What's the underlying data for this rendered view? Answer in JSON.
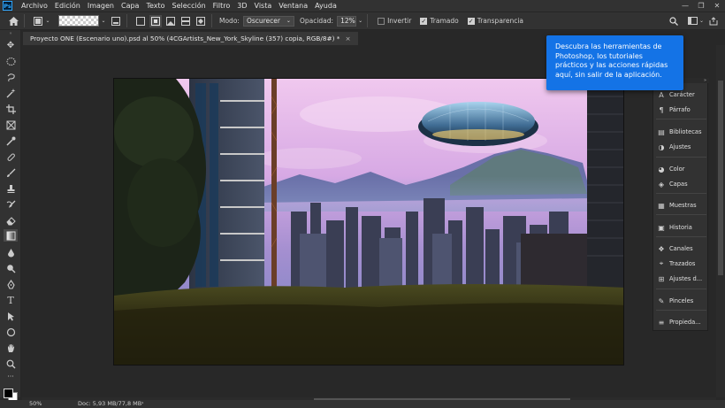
{
  "app": {
    "logo": "Ps"
  },
  "menu": [
    "Archivo",
    "Edición",
    "Imagen",
    "Capa",
    "Texto",
    "Selección",
    "Filtro",
    "3D",
    "Vista",
    "Ventana",
    "Ayuda"
  ],
  "window_controls": {
    "minimize": "—",
    "restore": "❐",
    "close": "✕"
  },
  "options": {
    "mode_label": "Modo:",
    "mode_value": "Oscurecer",
    "opacity_label": "Opacidad:",
    "opacity_value": "12%",
    "invertir_label": "Invertir",
    "invertir_checked": false,
    "tramado_label": "Tramado",
    "tramado_checked": true,
    "transparencia_label": "Transparencia",
    "transparencia_checked": true
  },
  "document": {
    "tab_title": "Proyecto ONE (Escenario uno).psd al 50% (4CGArtists_New_York_Skyline (357) copia, RGB/8#) *",
    "close": "×"
  },
  "status": {
    "zoom": "50%",
    "doc_size": "Doc: 5,93 MB/77,8 MB",
    "arrow": "›"
  },
  "tooltip": {
    "text": "Descubra las herramientas de Photoshop, los tutoriales prácticos y las acciones rápidas aquí, sin salir de la aplicación."
  },
  "panels": [
    {
      "label": "Carácter",
      "icon": "character-icon"
    },
    {
      "label": "Párrafo",
      "icon": "paragraph-icon"
    },
    {
      "label": "Bibliotecas",
      "icon": "libraries-icon"
    },
    {
      "label": "Ajustes",
      "icon": "adjustments-icon"
    },
    {
      "label": "Color",
      "icon": "color-icon"
    },
    {
      "label": "Capas",
      "icon": "layers-icon"
    },
    {
      "label": "Muestras",
      "icon": "swatches-icon"
    },
    {
      "label": "Historia",
      "icon": "history-icon"
    },
    {
      "label": "Canales",
      "icon": "channels-icon"
    },
    {
      "label": "Trazados",
      "icon": "paths-icon"
    },
    {
      "label": "Ajustes d...",
      "icon": "adjustment-presets-icon"
    },
    {
      "label": "Pinceles",
      "icon": "brushes-icon"
    },
    {
      "label": "Propieda...",
      "icon": "properties-icon"
    }
  ],
  "colors": {
    "accent": "#1473e6",
    "bg": "#282828",
    "panel": "#323232"
  }
}
